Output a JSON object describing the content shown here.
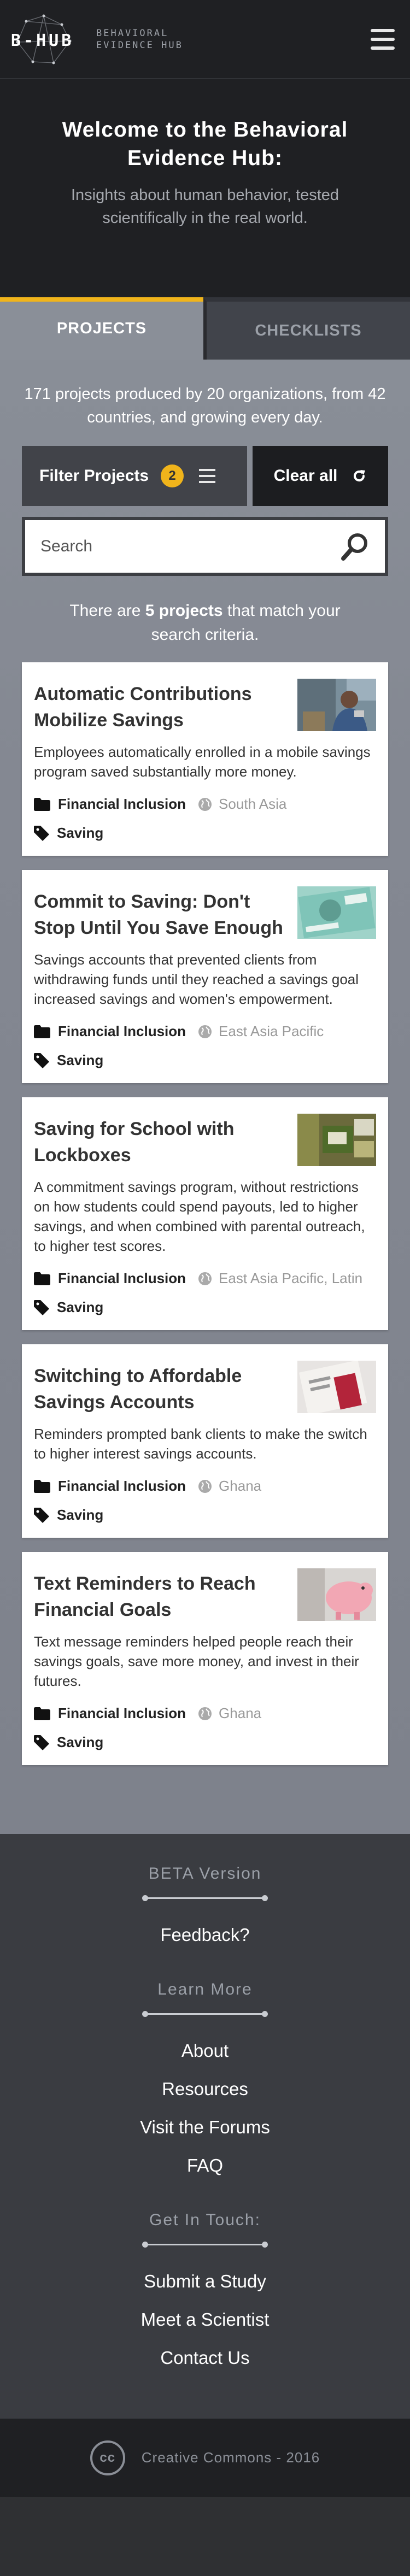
{
  "header": {
    "logo_text": "B-HUB",
    "brand_sub": "BEHAVIORAL EVIDENCE HUB",
    "menu_icon": "hamburger-icon"
  },
  "hero": {
    "title": "Welcome to the Behavioral Evidence Hub:",
    "subtitle": "Insights about human behavior, tested scientifically in the real world."
  },
  "tabs": [
    {
      "label": "PROJECTS",
      "active": true
    },
    {
      "label": "CHECKLISTS",
      "active": false
    }
  ],
  "stats_text": "171 projects produced by 20 organizations, from 42 countries, and growing every day.",
  "filters": {
    "label": "Filter Projects",
    "count": "2",
    "clear_label": "Clear all",
    "clear_icon": "refresh-icon"
  },
  "search": {
    "placeholder": "Search",
    "value": "",
    "icon": "search-icon"
  },
  "match": {
    "prefix": "There are",
    "count": "5 projects",
    "suffix": "that match your search criteria."
  },
  "projects": [
    {
      "title": "Automatic Contributions Mobilize Savings",
      "description": "Employees automatically enrolled in a mobile savings program saved substantially more money.",
      "category": "Financial Inclusion",
      "region": "South Asia",
      "tag": "Saving"
    },
    {
      "title": "Commit to Saving: Don't Stop Until You Save Enough",
      "description": "Savings accounts that prevented clients from withdrawing funds until they reached a savings goal increased savings and women's empowerment.",
      "category": "Financial Inclusion",
      "region": "East Asia Pacific",
      "tag": "Saving"
    },
    {
      "title": "Saving for School with Lockboxes",
      "description": "A commitment savings program, without restrictions on how students could spend payouts, led to higher savings, and when combined with parental outreach, to higher test scores.",
      "category": "Financial Inclusion",
      "region": "East Asia Pacific,  Latin",
      "tag": "Saving"
    },
    {
      "title": "Switching to Affordable Savings Accounts",
      "description": "Reminders prompted bank clients to make the switch to higher interest savings accounts.",
      "category": "Financial Inclusion",
      "region": "Ghana",
      "tag": "Saving"
    },
    {
      "title": "Text Reminders to Reach Financial Goals",
      "description": "Text message reminders helped people reach their savings goals, save more money, and invest in their futures.",
      "category": "Financial Inclusion",
      "region": "Ghana",
      "tag": "Saving"
    }
  ],
  "footer": {
    "beta_heading": "BETA Version",
    "feedback": "Feedback?",
    "learn_heading": "Learn More",
    "learn_links": [
      "About",
      "Resources",
      "Visit the Forums",
      "FAQ"
    ],
    "contact_heading": "Get In Touch:",
    "contact_links": [
      "Submit a Study",
      "Meet a Scientist",
      "Contact Us"
    ],
    "cc_icon": "cc",
    "copyright": "Creative Commons - 2016"
  },
  "colors": {
    "accent": "#f0b41b",
    "dark": "#1f2023",
    "panel": "#8a8f98"
  }
}
